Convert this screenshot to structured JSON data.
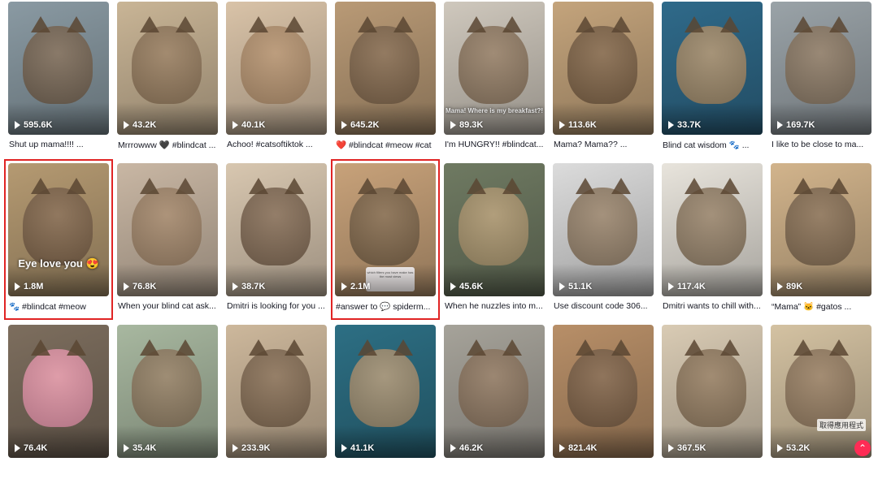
{
  "videos": [
    {
      "views": "595.6K",
      "caption": "Shut up mama!!!! ...",
      "bg": "#8a9aa3",
      "accent": "#5a4a3a",
      "overlay": "",
      "row": 0,
      "col": 0
    },
    {
      "views": "43.2K",
      "caption": "Mrrrowww 🖤 #blindcat ...",
      "bg": "#c9b596",
      "accent": "#6e5a44",
      "overlay": "",
      "row": 0,
      "col": 1
    },
    {
      "views": "40.1K",
      "caption": "Achoo! #catsoftiktok ...",
      "bg": "#d9c3a8",
      "accent": "#8a6e52",
      "overlay": "",
      "row": 0,
      "col": 2
    },
    {
      "views": "645.2K",
      "caption": "❤️ #blindcat #meow #cat",
      "bg": "#b99a76",
      "accent": "#5e4b38",
      "overlay": "",
      "row": 0,
      "col": 3
    },
    {
      "views": "89.3K",
      "caption": "I'm HUNGRY!! #blindcat...",
      "bg": "#cfc8bd",
      "accent": "#6a5845",
      "overlay": "Mama! Where is my breakfast?!",
      "row": 0,
      "col": 4
    },
    {
      "views": "113.6K",
      "caption": "Mama? Mama?? ...",
      "bg": "#c4a47c",
      "accent": "#5a4632",
      "overlay": "",
      "row": 0,
      "col": 5
    },
    {
      "views": "33.7K",
      "caption": "Blind cat wisdom 🐾 ...",
      "bg": "#2f6a8a",
      "accent": "#8a7050",
      "overlay": "",
      "row": 0,
      "col": 6
    },
    {
      "views": "169.7K",
      "caption": "I like to be close to ma...",
      "bg": "#9aa3a8",
      "accent": "#6a5a48",
      "overlay": "",
      "row": 0,
      "col": 7
    },
    {
      "views": "1.8M",
      "caption": "🐾 #blindcat #meow",
      "bg": "#b59a72",
      "accent": "#5c4836",
      "overlay": "Eye love you 😍",
      "row": 1,
      "col": 0
    },
    {
      "views": "76.8K",
      "caption": "When your blind cat ask...",
      "bg": "#c9b7a4",
      "accent": "#7a644e",
      "overlay": "",
      "row": 1,
      "col": 1
    },
    {
      "views": "38.7K",
      "caption": "Dmitri is looking for you ...",
      "bg": "#d8c7b0",
      "accent": "#5a4838",
      "overlay": "",
      "row": 1,
      "col": 2
    },
    {
      "views": "2.1M",
      "caption": "#answer to 💬 spiderm...",
      "bg": "#c8a27a",
      "accent": "#5b4a36",
      "overlay": "",
      "row": 1,
      "col": 3
    },
    {
      "views": "45.6K",
      "caption": "When he nuzzles into m...",
      "bg": "#6f7a62",
      "accent": "#8d7a5a",
      "overlay": "",
      "row": 1,
      "col": 4
    },
    {
      "views": "51.1K",
      "caption": "Use discount code 306...",
      "bg": "#dcdcdc",
      "accent": "#6d5c48",
      "overlay": "",
      "row": 1,
      "col": 5
    },
    {
      "views": "117.4K",
      "caption": "Dmitri wants to chill with...",
      "bg": "#e8e4dc",
      "accent": "#6a5a46",
      "overlay": "",
      "row": 1,
      "col": 6
    },
    {
      "views": "89K",
      "caption": "“Mama” 🐱 #gatos ...",
      "bg": "#d2b48c",
      "accent": "#5f4e3c",
      "overlay": "",
      "row": 1,
      "col": 7
    },
    {
      "views": "76.4K",
      "caption": "",
      "bg": "#7d6e5e",
      "accent": "#c07a90",
      "overlay": "",
      "row": 2,
      "col": 0
    },
    {
      "views": "35.4K",
      "caption": "",
      "bg": "#a8b8a0",
      "accent": "#6e5c48",
      "overlay": "",
      "row": 2,
      "col": 1
    },
    {
      "views": "233.9K",
      "caption": "",
      "bg": "#cdb89c",
      "accent": "#5e4c3a",
      "overlay": "",
      "row": 2,
      "col": 2
    },
    {
      "views": "41.1K",
      "caption": "",
      "bg": "#2d6f84",
      "accent": "#8a7458",
      "overlay": "",
      "row": 2,
      "col": 3
    },
    {
      "views": "46.2K",
      "caption": "",
      "bg": "#a6a39a",
      "accent": "#6b5846",
      "overlay": "",
      "row": 2,
      "col": 4
    },
    {
      "views": "821.4K",
      "caption": "",
      "bg": "#b88f68",
      "accent": "#5a4634",
      "overlay": "",
      "row": 2,
      "col": 5
    },
    {
      "views": "367.5K",
      "caption": "",
      "bg": "#d9cbb4",
      "accent": "#6a5843",
      "overlay": "",
      "row": 2,
      "col": 6
    },
    {
      "views": "53.2K",
      "caption": "",
      "bg": "#d4c2a2",
      "accent": "#6d5a46",
      "overlay": "",
      "row": 2,
      "col": 7
    }
  ],
  "highlighted": [
    8,
    11
  ],
  "sticker_text": "which filters you have make has the most views",
  "app_hint": "取得應用程式",
  "colors": {
    "highlight": "#e02424",
    "brand": "#fe2c55"
  }
}
